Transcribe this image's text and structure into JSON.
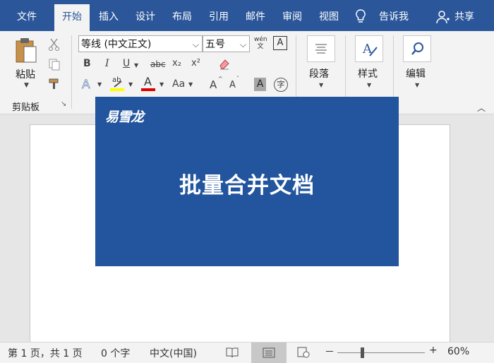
{
  "menubar": {
    "tabs": [
      "文件",
      "开始",
      "插入",
      "设计",
      "布局",
      "引用",
      "邮件",
      "审阅",
      "视图"
    ],
    "active_tab": "开始",
    "tell_me": "告诉我",
    "share": "共享"
  },
  "ribbon": {
    "clipboard": {
      "paste_label": "粘贴",
      "group_label": "剪贴板"
    },
    "font": {
      "font_name": "等线 (中文正文)",
      "font_size": "五号",
      "pinyin_label": "wén 文",
      "bold": "B",
      "italic": "I",
      "underline": "U",
      "strike": "abc",
      "subscript": "x₂",
      "superscript": "x²",
      "text_effect": "A",
      "highlight_text": "ab",
      "font_color_text": "A",
      "change_case": "Aa",
      "grow": "A",
      "shrink": "A",
      "shading": "A",
      "enclose": "字"
    },
    "paragraph_label": "段落",
    "styles_label": "样式",
    "editing_label": "编辑"
  },
  "banner": {
    "logo": "易雪龙",
    "title": "批量合并文档"
  },
  "statusbar": {
    "page": "第 1 页，共 1 页",
    "words": "0 个字",
    "language": "中文(中国)",
    "zoom_minus": "－",
    "zoom_plus": "+",
    "zoom_level": "60%"
  },
  "colors": {
    "title_bar": "#2b579a",
    "banner": "#22559e",
    "highlight": "#ffff00",
    "font_color": "#e00000"
  }
}
